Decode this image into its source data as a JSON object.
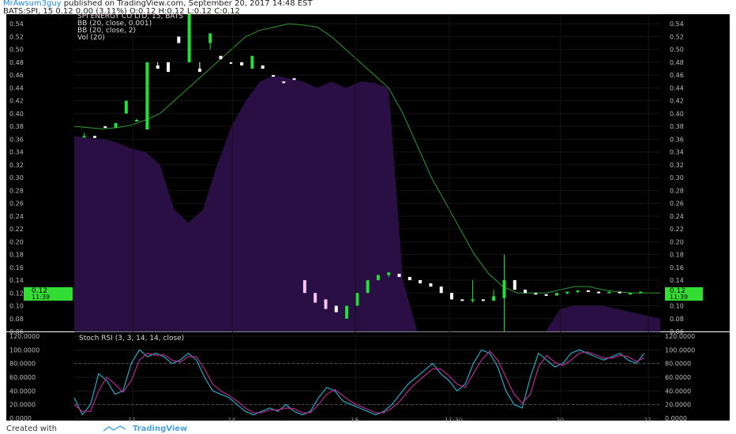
{
  "header": {
    "author": "MrAwsum3guy",
    "published": "published on TradingView.com, September 20, 2017 14:48 EST",
    "symbol_line": "BATS:SPI, 15  0.12 0.00 (3.11%) O:0.12 H:0.12 L:0.12 C:0.12"
  },
  "legend": {
    "title": "SPI ENERGY CO LTD, 15, BATS",
    "bb1": "BB (20, close, 0.001)",
    "bb2": "BB (20, close, 2)",
    "vol": "Vol (20)"
  },
  "price_labels": {
    "last_price": "0.12",
    "time_left": "11:39"
  },
  "stoch_title": "Stoch RSI (3, 3, 14, 14, close)",
  "footer": {
    "created_with": "Created with",
    "brand": "TradingView"
  },
  "colors": {
    "background": "#000000",
    "volume_fill": "#2a0f44",
    "bb_basis": "#2e9b2e",
    "bb_outer": "#6b0f0f",
    "up_candle": "#22e03a",
    "down_candle": "#ffffff",
    "down_candle_pink": "#f6c4f0",
    "stoch_k": "#26a9c6",
    "stoch_d": "#b42a8f",
    "price_tag": "#33dd33"
  },
  "chart_data": [
    {
      "type": "candlestick",
      "y_ticks": [
        "0.06",
        "0.08",
        "0.10",
        "0.12",
        "0.14",
        "0.16",
        "0.18",
        "0.20",
        "0.22",
        "0.24",
        "0.26",
        "0.28",
        "0.30",
        "0.32",
        "0.34",
        "0.36",
        "0.38",
        "0.40",
        "0.42",
        "0.44",
        "0.46",
        "0.48",
        "0.50",
        "0.52",
        "0.54"
      ],
      "x_ticks": [
        "11",
        "14",
        "18",
        "11:30",
        "20",
        "21"
      ],
      "ylim": [
        0.06,
        0.555
      ],
      "candles": [
        {
          "o": 0.365,
          "h": 0.37,
          "l": 0.365,
          "c": 0.365
        },
        {
          "o": 0.365,
          "h": 0.365,
          "l": 0.362,
          "c": 0.362
        },
        {
          "o": 0.38,
          "h": 0.38,
          "l": 0.378,
          "c": 0.378
        },
        {
          "o": 0.378,
          "h": 0.385,
          "l": 0.378,
          "c": 0.385
        },
        {
          "o": 0.4,
          "h": 0.42,
          "l": 0.4,
          "c": 0.42
        },
        {
          "o": 0.39,
          "h": 0.392,
          "l": 0.39,
          "c": 0.39
        },
        {
          "o": 0.375,
          "h": 0.48,
          "l": 0.375,
          "c": 0.48
        },
        {
          "o": 0.475,
          "h": 0.48,
          "l": 0.47,
          "c": 0.47
        },
        {
          "o": 0.48,
          "h": 0.48,
          "l": 0.465,
          "c": 0.465
        },
        {
          "o": 0.52,
          "h": 0.52,
          "l": 0.51,
          "c": 0.51
        },
        {
          "o": 0.48,
          "h": 0.555,
          "l": 0.48,
          "c": 0.555
        },
        {
          "o": 0.47,
          "h": 0.48,
          "l": 0.465,
          "c": 0.465
        },
        {
          "o": 0.51,
          "h": 0.525,
          "l": 0.5,
          "c": 0.525
        },
        {
          "o": 0.49,
          "h": 0.49,
          "l": 0.485,
          "c": 0.485
        },
        {
          "o": 0.48,
          "h": 0.48,
          "l": 0.478,
          "c": 0.478
        },
        {
          "o": 0.48,
          "h": 0.48,
          "l": 0.475,
          "c": 0.475
        },
        {
          "o": 0.47,
          "h": 0.49,
          "l": 0.47,
          "c": 0.49
        },
        {
          "o": 0.475,
          "h": 0.475,
          "l": 0.47,
          "c": 0.47
        },
        {
          "o": 0.46,
          "h": 0.46,
          "l": 0.458,
          "c": 0.458
        },
        {
          "o": 0.45,
          "h": 0.45,
          "l": 0.448,
          "c": 0.448
        },
        {
          "o": 0.455,
          "h": 0.455,
          "l": 0.453,
          "c": 0.453
        },
        {
          "o": 0.14,
          "h": 0.14,
          "l": 0.12,
          "c": 0.12
        },
        {
          "o": 0.12,
          "h": 0.12,
          "l": 0.105,
          "c": 0.105
        },
        {
          "o": 0.11,
          "h": 0.11,
          "l": 0.095,
          "c": 0.095
        },
        {
          "o": 0.1,
          "h": 0.1,
          "l": 0.09,
          "c": 0.09
        },
        {
          "o": 0.08,
          "h": 0.1,
          "l": 0.08,
          "c": 0.1
        },
        {
          "o": 0.1,
          "h": 0.12,
          "l": 0.1,
          "c": 0.12
        },
        {
          "o": 0.12,
          "h": 0.14,
          "l": 0.12,
          "c": 0.14
        },
        {
          "o": 0.14,
          "h": 0.148,
          "l": 0.14,
          "c": 0.148
        },
        {
          "o": 0.148,
          "h": 0.152,
          "l": 0.145,
          "c": 0.152
        },
        {
          "o": 0.15,
          "h": 0.15,
          "l": 0.145,
          "c": 0.145
        },
        {
          "o": 0.145,
          "h": 0.145,
          "l": 0.14,
          "c": 0.14
        },
        {
          "o": 0.14,
          "h": 0.14,
          "l": 0.135,
          "c": 0.135
        },
        {
          "o": 0.135,
          "h": 0.135,
          "l": 0.13,
          "c": 0.13
        },
        {
          "o": 0.13,
          "h": 0.13,
          "l": 0.12,
          "c": 0.12
        },
        {
          "o": 0.12,
          "h": 0.12,
          "l": 0.11,
          "c": 0.11
        },
        {
          "o": 0.11,
          "h": 0.11,
          "l": 0.108,
          "c": 0.108
        },
        {
          "o": 0.108,
          "h": 0.14,
          "l": 0.105,
          "c": 0.11
        },
        {
          "o": 0.11,
          "h": 0.11,
          "l": 0.108,
          "c": 0.108
        },
        {
          "o": 0.108,
          "h": 0.125,
          "l": 0.107,
          "c": 0.115
        },
        {
          "o": 0.112,
          "h": 0.18,
          "l": 0.06,
          "c": 0.14
        },
        {
          "o": 0.14,
          "h": 0.14,
          "l": 0.125,
          "c": 0.125
        },
        {
          "o": 0.125,
          "h": 0.125,
          "l": 0.12,
          "c": 0.12
        },
        {
          "o": 0.12,
          "h": 0.12,
          "l": 0.118,
          "c": 0.118
        },
        {
          "o": 0.118,
          "h": 0.118,
          "l": 0.116,
          "c": 0.116
        },
        {
          "o": 0.116,
          "h": 0.12,
          "l": 0.116,
          "c": 0.12
        },
        {
          "o": 0.12,
          "h": 0.122,
          "l": 0.118,
          "c": 0.122
        },
        {
          "o": 0.122,
          "h": 0.124,
          "l": 0.12,
          "c": 0.124
        },
        {
          "o": 0.124,
          "h": 0.124,
          "l": 0.122,
          "c": 0.122
        },
        {
          "o": 0.122,
          "h": 0.122,
          "l": 0.12,
          "c": 0.12
        },
        {
          "o": 0.12,
          "h": 0.122,
          "l": 0.12,
          "c": 0.122
        },
        {
          "o": 0.122,
          "h": 0.122,
          "l": 0.12,
          "c": 0.12
        },
        {
          "o": 0.12,
          "h": 0.121,
          "l": 0.119,
          "c": 0.12
        },
        {
          "o": 0.12,
          "h": 0.122,
          "l": 0.12,
          "c": 0.122
        }
      ],
      "bb_basis": [
        0.38,
        0.378,
        0.376,
        0.378,
        0.382,
        0.39,
        0.4,
        0.42,
        0.44,
        0.46,
        0.48,
        0.5,
        0.52,
        0.53,
        0.535,
        0.54,
        0.538,
        0.535,
        0.52,
        0.5,
        0.48,
        0.46,
        0.44,
        0.4,
        0.35,
        0.3,
        0.26,
        0.22,
        0.18,
        0.15,
        0.13,
        0.12,
        0.12,
        0.12,
        0.125,
        0.13,
        0.13,
        0.125,
        0.122,
        0.12,
        0.12,
        0.12
      ],
      "volume_area": [
        0.365,
        0.362,
        0.36,
        0.355,
        0.345,
        0.34,
        0.32,
        0.25,
        0.23,
        0.25,
        0.32,
        0.38,
        0.42,
        0.45,
        0.46,
        0.455,
        0.45,
        0.44,
        0.45,
        0.44,
        0.45,
        0.448,
        0.44,
        0.14,
        0.06,
        0.06,
        0.06,
        0.06,
        0.06,
        0.06,
        0.06,
        0.06,
        0.06,
        0.06,
        0.095,
        0.1,
        0.1,
        0.1,
        0.095,
        0.09,
        0.085,
        0.08
      ]
    },
    {
      "type": "line",
      "title": "Stoch RSI (3, 3, 14, 14, close)",
      "y_ticks": [
        "0.0000",
        "20.0000",
        "40.0000",
        "60.0000",
        "80.0000",
        "100.0000",
        "120.0000"
      ],
      "ylim": [
        0,
        120
      ],
      "series": [
        {
          "values": [
            30,
            5,
            20,
            65,
            55,
            35,
            40,
            80,
            100,
            90,
            95,
            90,
            80,
            85,
            95,
            85,
            60,
            40,
            35,
            30,
            20,
            10,
            5,
            10,
            15,
            10,
            20,
            10,
            5,
            10,
            30,
            45,
            40,
            25,
            20,
            15,
            10,
            5,
            10,
            20,
            35,
            50,
            60,
            70,
            80,
            65,
            55,
            40,
            50,
            80,
            100,
            95,
            75,
            40,
            20,
            15,
            60,
            95,
            85,
            75,
            80,
            95,
            100,
            95,
            90,
            85,
            90,
            95,
            85,
            80,
            95
          ]
        },
        {
          "values": [
            20,
            10,
            10,
            40,
            60,
            50,
            38,
            55,
            85,
            95,
            92,
            93,
            85,
            82,
            90,
            90,
            72,
            50,
            40,
            33,
            25,
            15,
            8,
            8,
            12,
            12,
            15,
            14,
            8,
            8,
            20,
            35,
            42,
            33,
            24,
            18,
            13,
            8,
            8,
            15,
            25,
            40,
            52,
            62,
            72,
            72,
            62,
            50,
            45,
            65,
            85,
            98,
            85,
            60,
            35,
            22,
            35,
            75,
            92,
            82,
            77,
            85,
            95,
            97,
            93,
            88,
            88,
            92,
            90,
            83,
            88
          ]
        }
      ]
    }
  ]
}
